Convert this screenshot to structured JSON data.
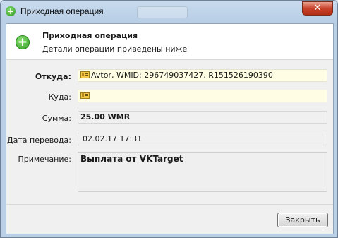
{
  "window": {
    "title": "Приходная операция",
    "close_glyph": "✕"
  },
  "header": {
    "title": "Приходная операция",
    "subtitle": "Детали операции приведены ниже",
    "icon": "plus-icon"
  },
  "fields": {
    "from": {
      "label": "Откуда:",
      "value": "Avtor, WMID: 296749037427, R151526190390",
      "icon": "id-card-icon"
    },
    "to": {
      "label": "Куда:",
      "value": "",
      "icon": "id-card-icon"
    },
    "amount": {
      "label": "Сумма:",
      "value": "25.00 WMR"
    },
    "date": {
      "label": "Дата перевода:",
      "value": "02.02.17 17:31"
    },
    "note": {
      "label": "Примечание:",
      "value": "Выплата от VKTarget"
    }
  },
  "buttons": {
    "close_label": "Закрыть"
  },
  "colors": {
    "field_yellow": "#fffee4",
    "window_frame": "#b9cfe6",
    "accent_green": "#2f9a23"
  }
}
